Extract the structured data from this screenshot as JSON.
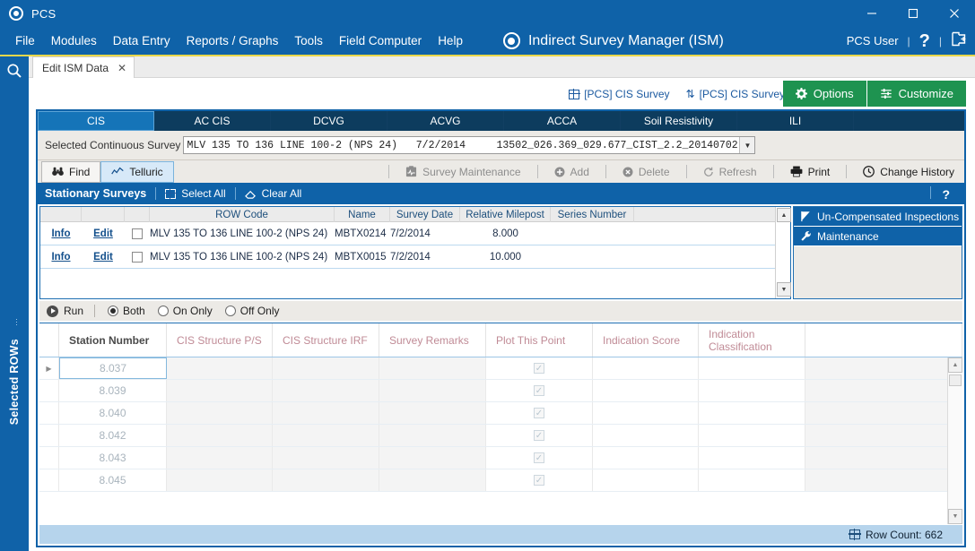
{
  "titlebar": {
    "app_name": "PCS",
    "minimize": "—",
    "maximize": "□",
    "close": "✕"
  },
  "menubar": {
    "items": [
      "File",
      "Modules",
      "Data Entry",
      "Reports / Graphs",
      "Tools",
      "Field Computer",
      "Help"
    ],
    "module_title": "Indirect Survey Manager (ISM)",
    "user": "PCS User",
    "help": "?",
    "logout": "➜"
  },
  "rail": {
    "search_icon": "search-icon",
    "vertical_label": "Selected ROWs"
  },
  "doc_tabs": [
    {
      "label": "Edit ISM Data",
      "close": "✕"
    }
  ],
  "quick_links": [
    {
      "icon": "grid-icon",
      "label": "[PCS] CIS Survey"
    },
    {
      "icon": "sort-icon",
      "label": "[PCS] CIS Survey"
    }
  ],
  "green_buttons": [
    {
      "icon": "gear-icon",
      "label": "Options"
    },
    {
      "icon": "sliders-icon",
      "label": "Customize"
    }
  ],
  "subtabs": [
    {
      "label": "CIS",
      "active": true
    },
    {
      "label": "AC CIS",
      "active": false
    },
    {
      "label": "DCVG",
      "active": false
    },
    {
      "label": "ACVG",
      "active": false
    },
    {
      "label": "ACCA",
      "active": false
    },
    {
      "label": "Soil Resistivity",
      "active": false
    },
    {
      "label": "ILI",
      "active": false
    }
  ],
  "selected_survey": {
    "label": "Selected Continuous Survey",
    "value": "MLV 135 TO 136 LINE 100-2 (NPS 24)   7/2/2014     13502_026.369_029.677_CIST_2.2_20140702",
    "dropdown_arrow": "▼"
  },
  "toolbar": {
    "left": [
      {
        "label": "Find",
        "icon": "binoculars-icon",
        "style": "outline"
      },
      {
        "label": "Telluric",
        "icon": "chart-line-icon",
        "style": "selected"
      }
    ],
    "right": [
      {
        "label": "Survey Maintenance",
        "icon": "clipboard-pulse-icon",
        "dim": true
      },
      {
        "label": "Add",
        "icon": "plus-circle-icon",
        "dim": true
      },
      {
        "label": "Delete",
        "icon": "x-circle-icon",
        "dim": true
      },
      {
        "label": "Refresh",
        "icon": "refresh-icon",
        "dim": true
      },
      {
        "label": "Print",
        "icon": "printer-icon",
        "dim": false
      },
      {
        "label": "Change History",
        "icon": "clock-icon",
        "dim": false
      }
    ]
  },
  "stationary": {
    "title": "Stationary Surveys",
    "select_all": "Select All",
    "clear_all": "Clear All",
    "help": "?",
    "columns": [
      "",
      "",
      "",
      "ROW Code",
      "Name",
      "Survey Date",
      "Relative Milepost",
      "Series Number",
      ""
    ],
    "rows": [
      {
        "info": "Info",
        "edit": "Edit",
        "checked": false,
        "row_code": "MLV 135 TO 136 LINE 100-2 (NPS 24)",
        "name": "MBTX0214",
        "survey_date": "7/2/2014",
        "relative_milepost": "8.000",
        "series_number": ""
      },
      {
        "info": "Info",
        "edit": "Edit",
        "checked": false,
        "row_code": "MLV 135 TO 136 LINE 100-2 (NPS 24)",
        "name": "MBTX0015",
        "survey_date": "7/2/2014",
        "relative_milepost": "10.000",
        "series_number": ""
      }
    ],
    "scroll_up": "▲",
    "scroll_down": "▼"
  },
  "side_buttons": [
    {
      "icon": "flag-icon",
      "label": "Un-Compensated Inspections"
    },
    {
      "icon": "wrench-icon",
      "label": "Maintenance"
    }
  ],
  "runbar": {
    "run_label": "Run",
    "options": [
      {
        "label": "Both",
        "selected": true
      },
      {
        "label": "On Only",
        "selected": false
      },
      {
        "label": "Off Only",
        "selected": false
      }
    ]
  },
  "datagrid": {
    "columns": [
      "Station Number",
      "CIS Structure P/S",
      "CIS Structure IRF",
      "Survey Remarks",
      "Plot This Point",
      "Indication Score",
      "Indication Classification",
      ""
    ],
    "rows": [
      {
        "station_number": "8.037",
        "cis_ps": "",
        "cis_irf": "",
        "survey_remarks": "",
        "plot_this_point": true,
        "indication_score": "",
        "indication_classification": ""
      },
      {
        "station_number": "8.039",
        "cis_ps": "",
        "cis_irf": "",
        "survey_remarks": "",
        "plot_this_point": true,
        "indication_score": "",
        "indication_classification": ""
      },
      {
        "station_number": "8.040",
        "cis_ps": "",
        "cis_irf": "",
        "survey_remarks": "",
        "plot_this_point": true,
        "indication_score": "",
        "indication_classification": ""
      },
      {
        "station_number": "8.042",
        "cis_ps": "",
        "cis_irf": "",
        "survey_remarks": "",
        "plot_this_point": true,
        "indication_score": "",
        "indication_classification": ""
      },
      {
        "station_number": "8.043",
        "cis_ps": "",
        "cis_irf": "",
        "survey_remarks": "",
        "plot_this_point": true,
        "indication_score": "",
        "indication_classification": ""
      },
      {
        "station_number": "8.045",
        "cis_ps": "",
        "cis_irf": "",
        "survey_remarks": "",
        "plot_this_point": true,
        "indication_score": "",
        "indication_classification": ""
      }
    ],
    "status_icon": "grid-icon",
    "status_text": "Row Count: 662"
  },
  "colors": {
    "brand_blue": "#0f62a8",
    "dark_navy": "#0d3c5e",
    "active_tab_blue": "#1574b8",
    "green": "#1e9350",
    "accent_yellow": "#e9d84b",
    "status_bar": "#b6d4ec"
  }
}
